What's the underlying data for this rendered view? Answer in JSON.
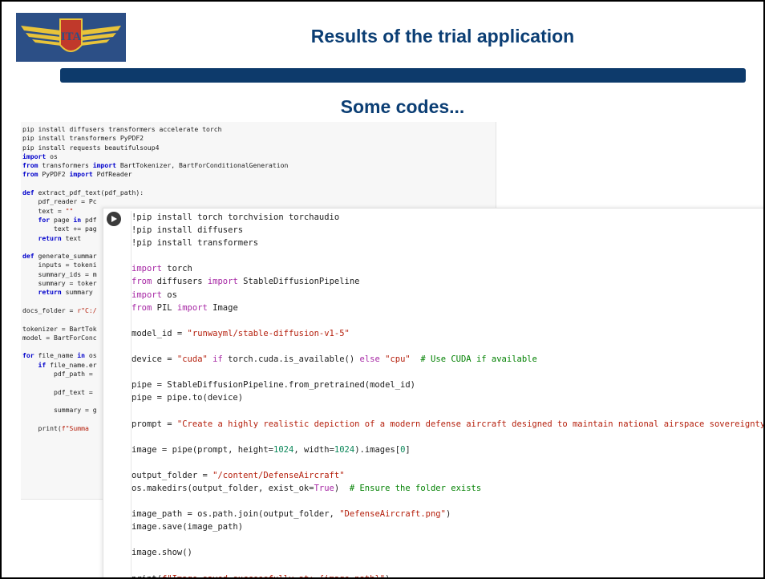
{
  "header": {
    "title": "Results of the trial application",
    "subtitle": "Some codes..."
  },
  "logo": {
    "icon": "ita-wings-logo",
    "text": "ITA"
  },
  "colors": {
    "title": "#0b3e74",
    "bar": "#0d3a6b",
    "logo_bg": "#2c4f86"
  },
  "code_back": {
    "lines": [
      "pip install diffusers transformers accelerate torch",
      "pip install transformers PyPDF2",
      "pip install requests beautifulsoup4",
      "import os",
      "from transformers import BartTokenizer, BartForConditionalGeneration",
      "from PyPDF2 import PdfReader",
      "",
      "def extract_pdf_text(pdf_path):",
      "    pdf_reader = Pc",
      "    text = \"\"",
      "    for page in pdf",
      "        text += pag",
      "    return text",
      "",
      "def generate_summar",
      "    inputs = tokeni",
      "    summary_ids = m",
      "    summary = toker",
      "    return summary",
      "",
      "docs_folder = r\"C:/",
      "",
      "tokenizer = BartTok",
      "model = BartForConc",
      "",
      "for file_name in os",
      "    if file_name.er",
      "        pdf_path =",
      "",
      "        pdf_text =",
      "",
      "        summary = g",
      "",
      "    print(f\"Summa"
    ]
  },
  "code_front": {
    "lines": [
      "!pip install torch torchvision torchaudio",
      "!pip install diffusers",
      "!pip install transformers",
      "",
      "import torch",
      "from diffusers import StableDiffusionPipeline",
      "import os",
      "from PIL import Image",
      "",
      "model_id = \"runwayml/stable-diffusion-v1-5\"",
      "",
      "device = \"cuda\" if torch.cuda.is_available() else \"cpu\"  # Use CUDA if available",
      "",
      "pipe = StableDiffusionPipeline.from_pretrained(model_id)",
      "pipe = pipe.to(device)",
      "",
      "prompt = \"Create a highly realistic depiction of a modern defense aircraft designed to maintain national airspace sovereignty a",
      "",
      "image = pipe(prompt, height=1024, width=1024).images[0]",
      "",
      "output_folder = \"/content/DefenseAircraft\"",
      "os.makedirs(output_folder, exist_ok=True)  # Ensure the folder exists",
      "",
      "image_path = os.path.join(output_folder, \"DefenseAircraft.png\")",
      "image.save(image_path)",
      "",
      "image.show()",
      "",
      "print(f\"Image saved successfully at: {image_path}\")"
    ]
  }
}
